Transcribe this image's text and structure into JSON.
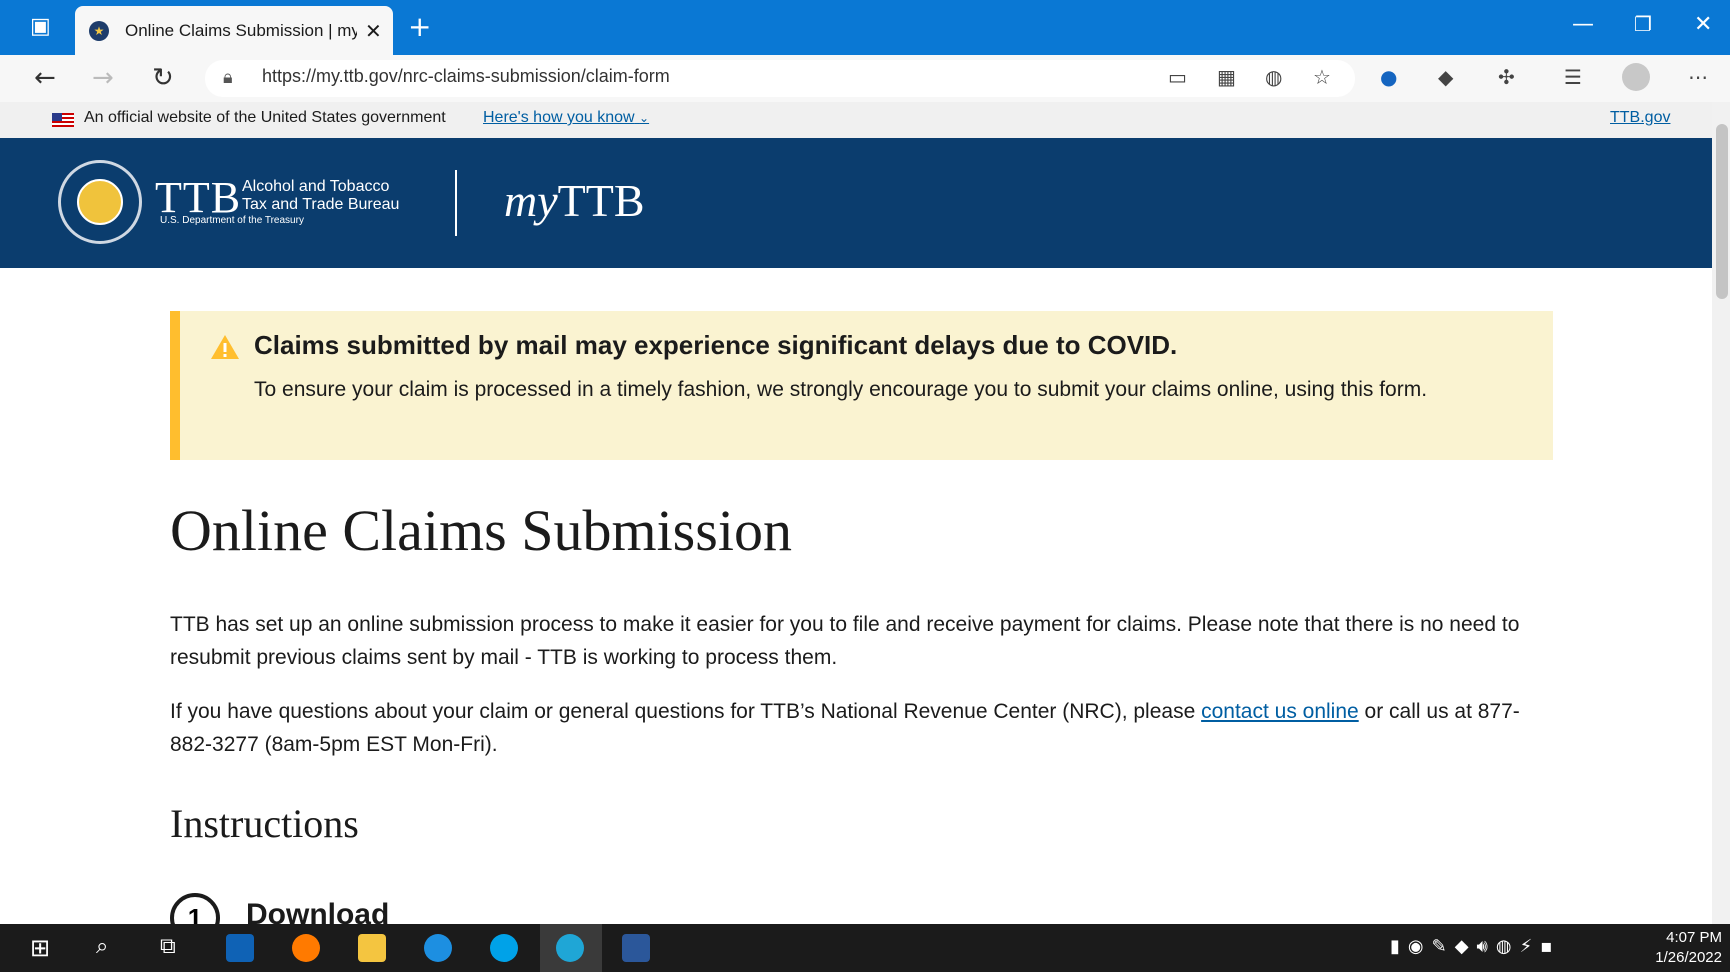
{
  "browser": {
    "tab_title": "Online Claims Submission | myTTB",
    "url": "https://my.ttb.gov/nrc-claims-submission/claim-form"
  },
  "gov_banner": {
    "text": "An official website of the United States government",
    "link": "Here's how you know",
    "right_link": "TTB.gov"
  },
  "header": {
    "logo_letters": "TTB",
    "logo_line1": "Alcohol and Tobacco",
    "logo_line2": "Tax and Trade Bureau",
    "logo_line3": "U.S. Department of the Treasury",
    "app_prefix": "my",
    "app_name": "TTB"
  },
  "alert": {
    "heading": "Claims submitted by mail may experience significant delays due to COVID.",
    "body": "To ensure your claim is processed in a timely fashion, we strongly encourage you to submit your claims online, using this form."
  },
  "page": {
    "title": "Online Claims Submission",
    "para1": "TTB has set up an online submission process to make it easier for you to file and receive payment for claims. Please note that there is no need to resubmit previous claims sent by mail - TTB is working to process them.",
    "para2_before": "If you have questions about your claim or general questions for TTB’s National Revenue Center (NRC), please ",
    "para2_link": "contact us online",
    "para2_after": " or call us at 877-882-3277 (8am-5pm EST Mon-Fri).",
    "instructions_heading": "Instructions",
    "step1_number": "1",
    "step1_label": "Download"
  },
  "taskbar": {
    "time": "4:07 PM",
    "date": "1/26/2022"
  },
  "colors": {
    "titlebar": "#0a78d4",
    "header_bg": "#0b3d6e",
    "alert_bg": "#faf3d1",
    "alert_border": "#ffbe2e",
    "link": "#005ea2"
  }
}
